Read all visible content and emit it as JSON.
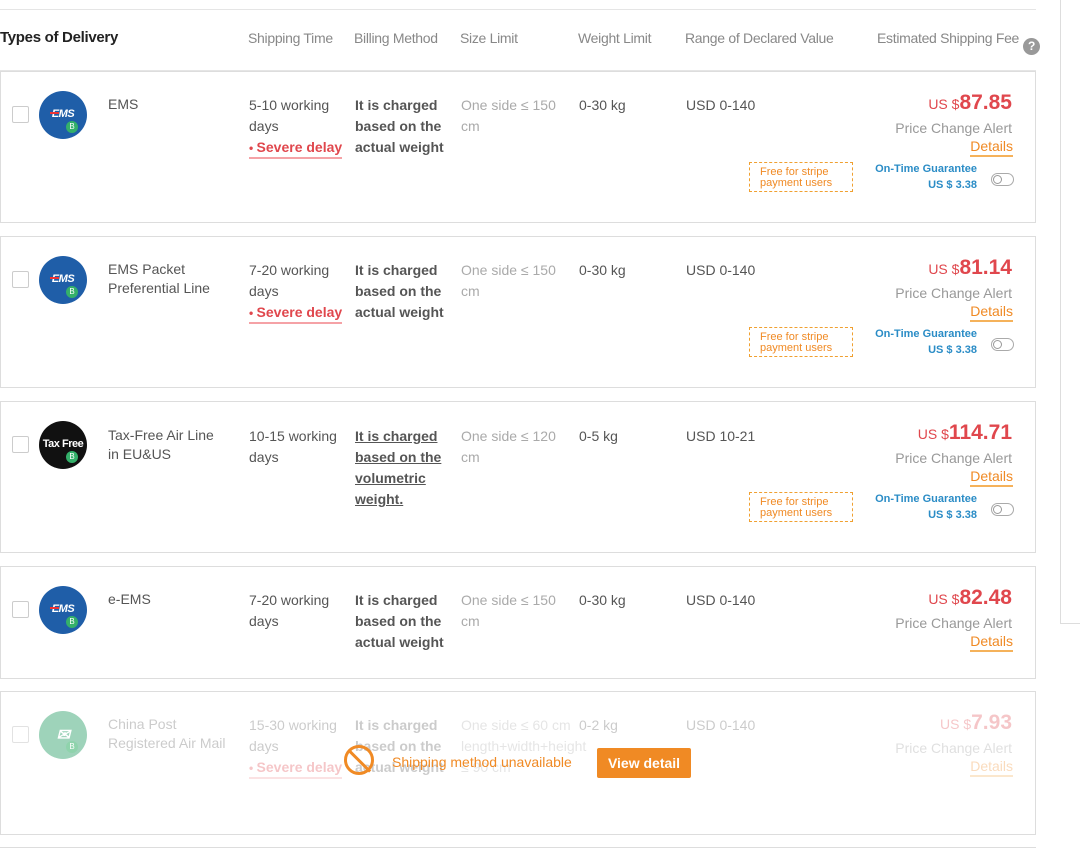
{
  "header": {
    "type": "Types of Delivery",
    "shipping_time": "Shipping Time",
    "billing_method": "Billing Method",
    "size_limit": "Size Limit",
    "weight_limit": "Weight Limit",
    "declared_value": "Range of Declared Value",
    "estimated_fee": "Estimated Shipping Fee",
    "help_icon": "?"
  },
  "labels": {
    "price_change_alert": "Price Change Alert",
    "details": "Details",
    "free_for_stripe": "Free for stripe payment users",
    "on_time_guarantee": "On-Time Guarantee",
    "severe_delay": "Severe delay",
    "currency": "US $"
  },
  "rows": [
    {
      "logo": "EMS",
      "name": "EMS",
      "time": "5-10 working days",
      "severe": true,
      "billing": "It is charged based on the actual weight",
      "size": "One side ≤ 150 cm",
      "weight": "0-30 kg",
      "declared": "USD 0-140",
      "price": "87.85",
      "guarantee": "US $ 3.38"
    },
    {
      "logo": "EMS",
      "name": "EMS Packet Preferential Line",
      "time": "7-20 working days",
      "severe": true,
      "billing": "It is charged based on the actual weight",
      "size": "One side ≤ 150 cm",
      "weight": "0-30 kg",
      "declared": "USD 0-140",
      "price": "81.14",
      "guarantee": "US $ 3.38"
    },
    {
      "logo": "Tax Free",
      "name": "Tax-Free Air Line in EU&US",
      "time": "10-15 working days",
      "severe": false,
      "billing": "It is charged based on the volumetric weight.",
      "size": "One side ≤ 120 cm",
      "weight": "0-5 kg",
      "declared": "USD 10-21",
      "price": "114.71",
      "guarantee": "US $ 3.38"
    },
    {
      "logo": "EMS",
      "name": "e-EMS",
      "time": "7-20 working days",
      "severe": false,
      "billing": "It is charged based on the actual weight",
      "size": "One side ≤ 150 cm",
      "weight": "0-30 kg",
      "declared": "USD 0-140",
      "price": "82.48"
    },
    {
      "logo": "",
      "name": "China Post Registered Air Mail",
      "time": "15-30 working days",
      "severe": true,
      "billing": "It is charged based on the actual weight",
      "size": "One side ≤ 60 cm",
      "size_extra": "length+width+height ≤ 90 cm",
      "weight": "0-2 kg",
      "declared": "USD 0-140",
      "price": "7.93",
      "unavailable": "Shipping method unavailable",
      "view_detail": "View detail"
    }
  ],
  "colors": {
    "accent": "#f08a24",
    "price": "#e0474d",
    "guarantee": "#2a8cc6",
    "ems": "#1f5ea8"
  }
}
